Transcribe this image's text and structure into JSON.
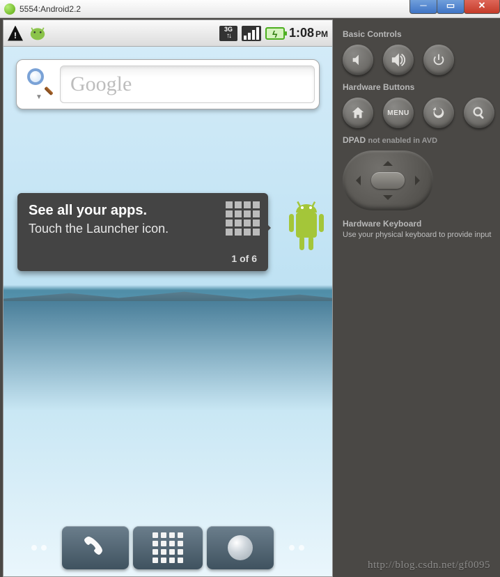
{
  "window": {
    "title": "5554:Android2.2"
  },
  "status": {
    "threeg": "3G",
    "time": "1:08",
    "ampm": "PM"
  },
  "search": {
    "placeholder": "Google"
  },
  "hint": {
    "title": "See all your apps.",
    "body": "Touch the Launcher icon.",
    "pager": "1 of 6"
  },
  "side": {
    "basic_label": "Basic Controls",
    "hw_label": "Hardware Buttons",
    "menu": "MENU",
    "dpad_label": "DPAD",
    "dpad_status": "not enabled in AVD",
    "kb_label": "Hardware Keyboard",
    "kb_desc": "Use your physical keyboard to provide input"
  },
  "watermark": "http://blog.csdn.net/gf0095"
}
